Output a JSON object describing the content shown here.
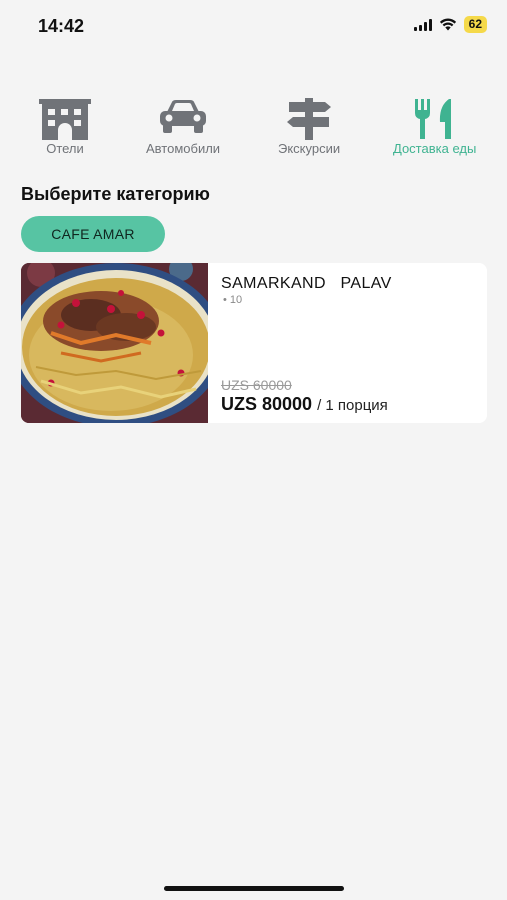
{
  "status_bar": {
    "time": "14:42",
    "battery": "62",
    "icons": [
      "signal-icon",
      "wifi-icon",
      "battery-icon"
    ]
  },
  "nav": {
    "items": [
      {
        "label": "Отели",
        "icon": "hotel-icon",
        "active": false
      },
      {
        "label": "Автомобили",
        "icon": "car-icon",
        "active": false
      },
      {
        "label": "Экскурсии",
        "icon": "signpost-icon",
        "active": false
      },
      {
        "label": "Доставка еды",
        "icon": "fork-knife-icon",
        "active": true
      }
    ]
  },
  "content": {
    "section_title": "Выберите категорию",
    "category": "CAFE AMAR",
    "product": {
      "name": "SAMARKAND   PALAV",
      "rating": "10",
      "old_price": "UZS 60000",
      "price": "UZS 80000",
      "portion": "/ 1 порция",
      "image": "plov-dish-photo"
    }
  },
  "colors": {
    "accent": "#3fb391",
    "chip": "#57c4a3",
    "icon_inactive": "#707378",
    "battery": "#f5d94a"
  }
}
